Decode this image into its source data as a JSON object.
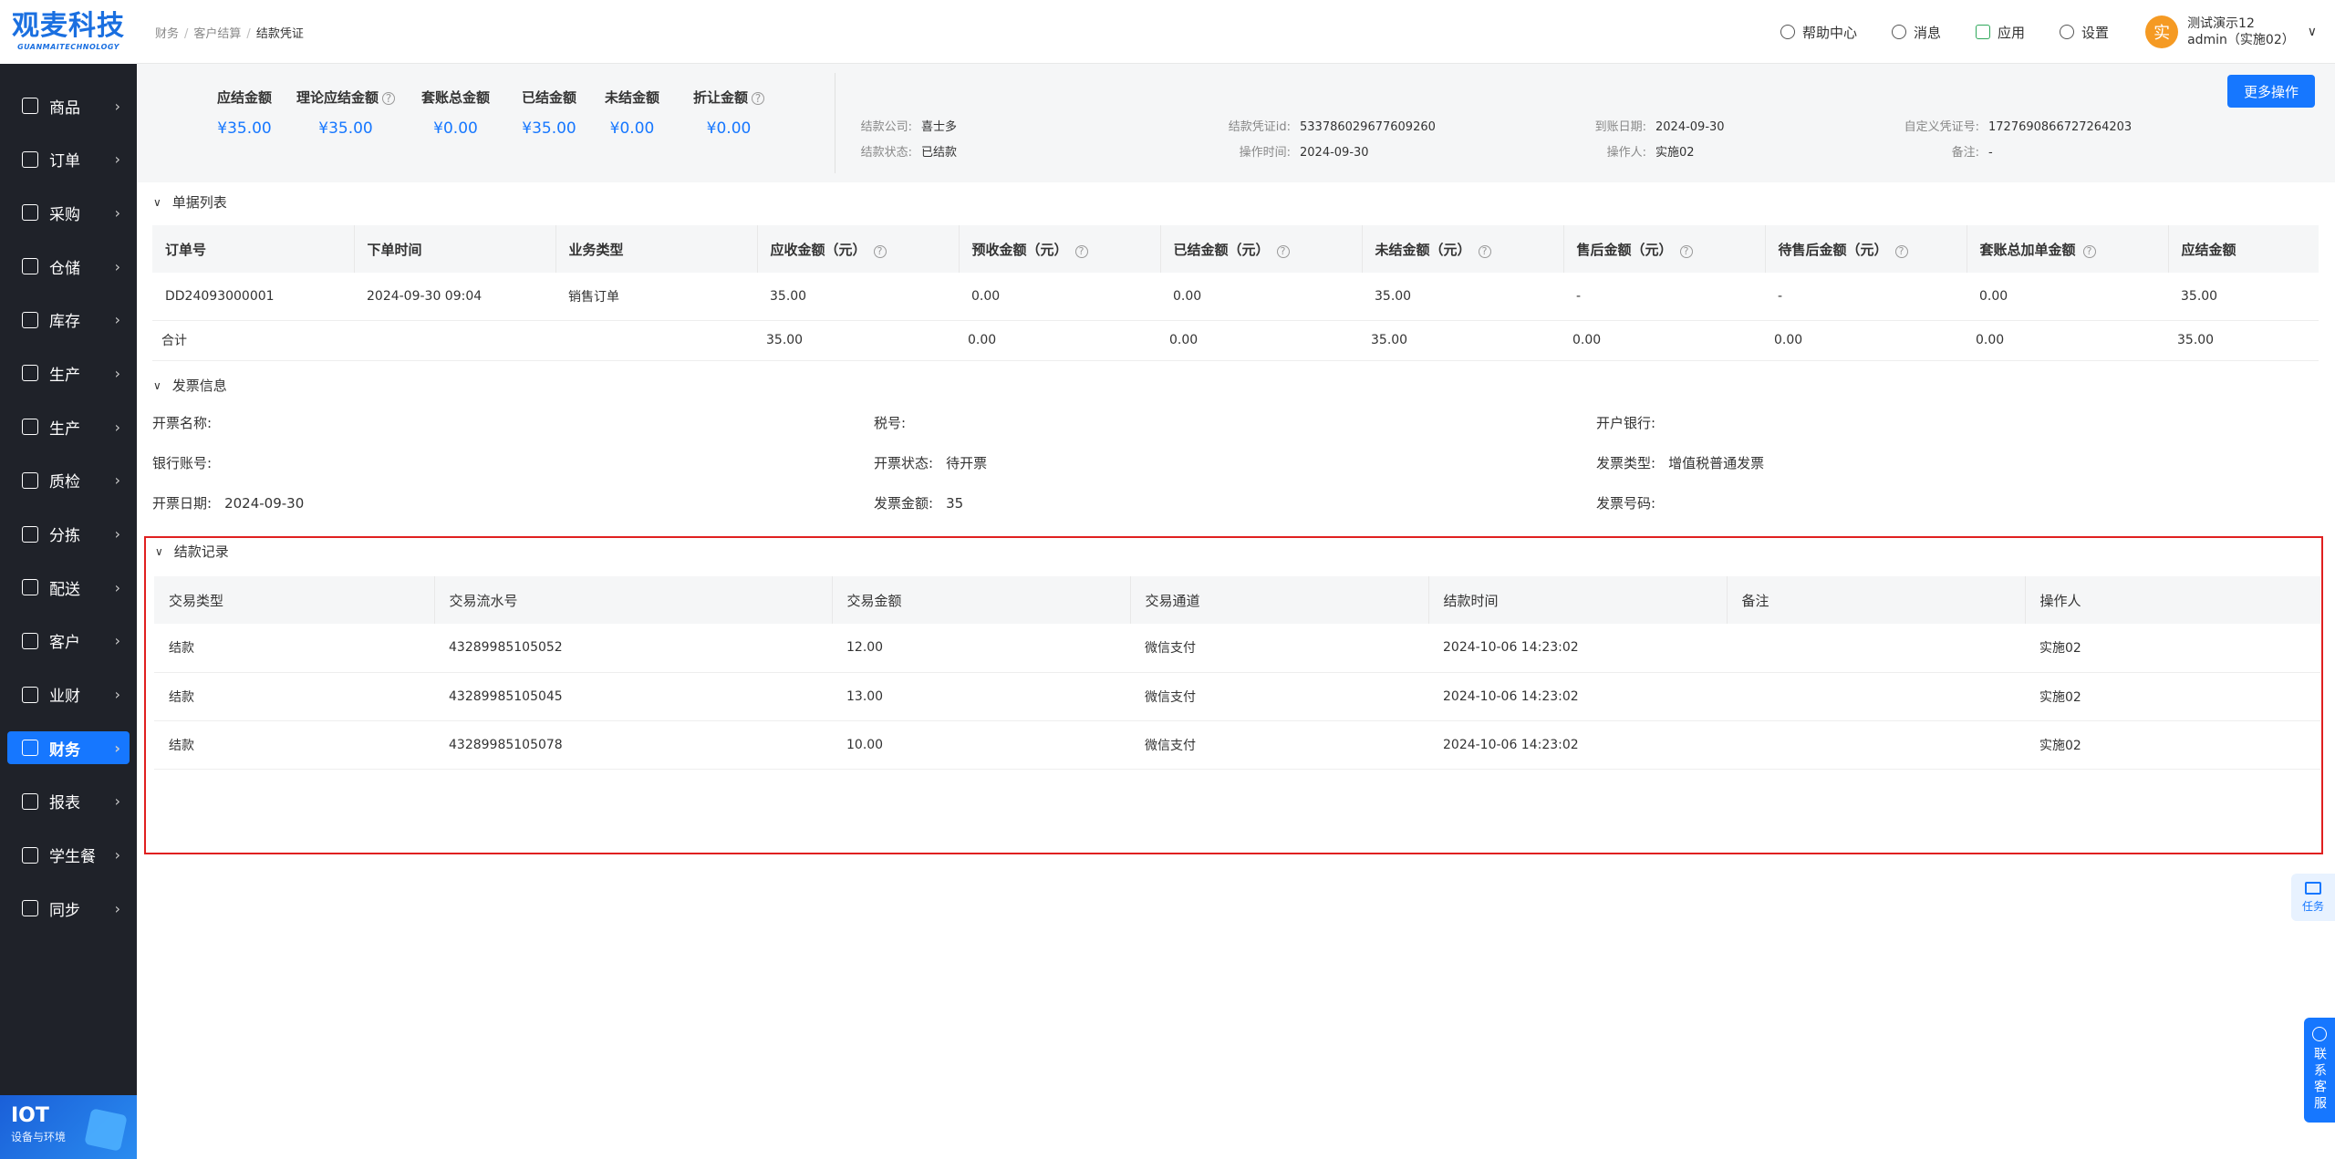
{
  "logo": {
    "cn": "观麦科技",
    "en": "GUANMAITECHNOLOGY"
  },
  "sidebar": {
    "items": [
      {
        "label": "商品",
        "icon": "grid-icon"
      },
      {
        "label": "订单",
        "icon": "order-icon"
      },
      {
        "label": "采购",
        "icon": "purchase-icon"
      },
      {
        "label": "仓储",
        "icon": "warehouse-icon"
      },
      {
        "label": "库存",
        "icon": "stock-icon"
      },
      {
        "label": "生产",
        "icon": "factory-icon"
      },
      {
        "label": "生产",
        "icon": "factory-icon"
      },
      {
        "label": "质检",
        "icon": "shield-icon"
      },
      {
        "label": "分拣",
        "icon": "sort-icon"
      },
      {
        "label": "配送",
        "icon": "truck-icon"
      },
      {
        "label": "客户",
        "icon": "user-icon"
      },
      {
        "label": "业财",
        "icon": "chart-icon"
      },
      {
        "label": "财务",
        "icon": "finance-icon",
        "active": true
      },
      {
        "label": "报表",
        "icon": "report-icon"
      },
      {
        "label": "学生餐",
        "icon": "meal-icon"
      },
      {
        "label": "同步",
        "icon": "sync-icon"
      }
    ],
    "iot": {
      "title": "IOT",
      "subtitle": "设备与环境"
    }
  },
  "header": {
    "breadcrumb": [
      "财务",
      "客户结算",
      "结款凭证"
    ],
    "help": "帮助中心",
    "messages": "消息",
    "apps": "应用",
    "settings": "设置",
    "avatar_text": "实",
    "user_line1": "测试演示12",
    "user_line2": "admin（实施02）"
  },
  "summary": {
    "items": [
      {
        "label": "应结金额",
        "value": "¥35.00",
        "help": false
      },
      {
        "label": "理论应结金额",
        "value": "¥35.00",
        "help": true
      },
      {
        "label": "套账总金额",
        "value": "¥0.00",
        "help": false
      },
      {
        "label": "已结金额",
        "value": "¥35.00",
        "help": false
      },
      {
        "label": "未结金额",
        "value": "¥0.00",
        "help": false
      },
      {
        "label": "折让金额",
        "value": "¥0.00",
        "help": true
      }
    ],
    "meta": {
      "company_label": "结款公司:",
      "company": "喜士多",
      "status_label": "结款状态:",
      "status": "已结款",
      "voucher_label": "结款凭证id:",
      "voucher": "533786029677609260",
      "optime_label": "操作时间:",
      "optime": "2024-09-30",
      "date_label": "到账日期:",
      "date": "2024-09-30",
      "operator_label": "操作人:",
      "operator": "实施02",
      "custom_label": "自定义凭证号:",
      "custom": "1727690866727264203",
      "remark_label": "备注:",
      "remark": "-"
    },
    "more_button": "更多操作"
  },
  "orders": {
    "title": "单据列表",
    "headers": [
      "订单号",
      "下单时间",
      "业务类型",
      "应收金额（元）",
      "预收金额（元）",
      "已结金额（元）",
      "未结金额（元）",
      "售后金额（元）",
      "待售后金额（元）",
      "套账总加单金额",
      "应结金额"
    ],
    "help_cols": [
      false,
      false,
      false,
      true,
      true,
      true,
      true,
      true,
      true,
      true,
      false
    ],
    "rows": [
      [
        "DD24093000001",
        "2024-09-30 09:04",
        "销售订单",
        "35.00",
        "0.00",
        "0.00",
        "35.00",
        "-",
        "-",
        "0.00",
        "35.00"
      ]
    ],
    "total": [
      "合计",
      "",
      "",
      "35.00",
      "0.00",
      "0.00",
      "35.00",
      "0.00",
      "0.00",
      "0.00",
      "35.00"
    ]
  },
  "invoice": {
    "title": "发票信息",
    "fields": [
      {
        "label": "开票名称:",
        "value": ""
      },
      {
        "label": "税号:",
        "value": ""
      },
      {
        "label": "开户银行:",
        "value": ""
      },
      {
        "label": "银行账号:",
        "value": ""
      },
      {
        "label": "开票状态:",
        "value": "待开票"
      },
      {
        "label": "发票类型:",
        "value": "增值税普通发票"
      },
      {
        "label": "开票日期:",
        "value": "2024-09-30"
      },
      {
        "label": "发票金额:",
        "value": "35"
      },
      {
        "label": "发票号码:",
        "value": ""
      }
    ]
  },
  "records": {
    "title": "结款记录",
    "headers": [
      "交易类型",
      "交易流水号",
      "交易金额",
      "交易通道",
      "结款时间",
      "备注",
      "操作人"
    ],
    "rows": [
      [
        "结款",
        "43289985105052",
        "12.00",
        "微信支付",
        "2024-10-06 14:23:02",
        "",
        "实施02"
      ],
      [
        "结款",
        "43289985105045",
        "13.00",
        "微信支付",
        "2024-10-06 14:23:02",
        "",
        "实施02"
      ],
      [
        "结款",
        "43289985105078",
        "10.00",
        "微信支付",
        "2024-10-06 14:23:02",
        "",
        "实施02"
      ]
    ]
  },
  "float": {
    "task": "任务",
    "contact": "联系客服"
  },
  "colors": {
    "accent": "#1677ff",
    "highlight": "#e02020",
    "sidebar": "#1f2229"
  }
}
